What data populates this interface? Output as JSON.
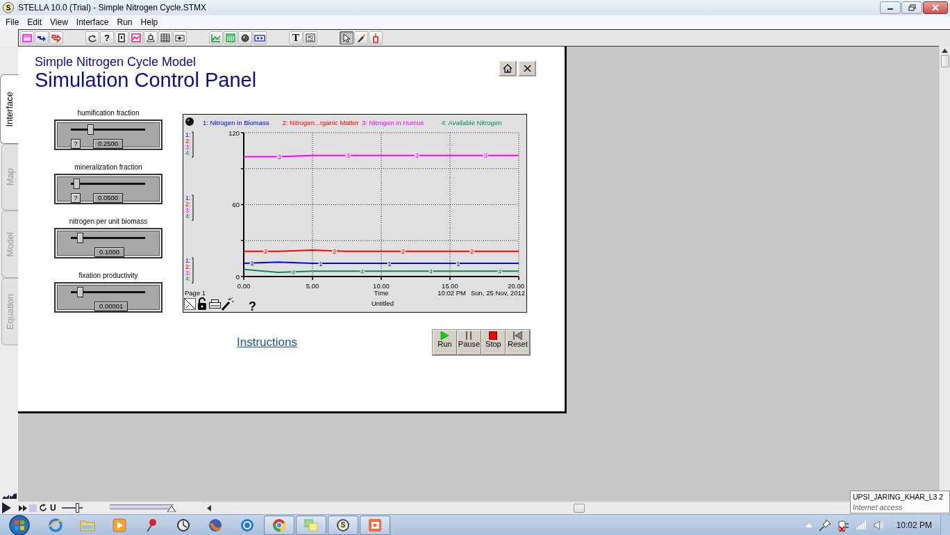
{
  "window": {
    "icon_letter": "S",
    "title": "STELLA 10.0 (Trial) - Simple Nitrogen Cycle.STMX"
  },
  "menu": [
    "File",
    "Edit",
    "View",
    "Interface",
    "Run",
    "Help"
  ],
  "toolbar": {
    "groups": [
      {
        "buttons": [
          {
            "selected": false
          },
          {
            "selected": false
          },
          {
            "selected": false
          }
        ]
      },
      {
        "buttons": [
          {
            "selected": false
          },
          {
            "label": "?",
            "selected": false
          },
          {
            "selected": false
          },
          {
            "selected": false
          },
          {
            "selected": false
          },
          {
            "selected": false
          },
          {
            "selected": false
          }
        ]
      },
      {
        "buttons": [
          {
            "selected": false
          },
          {
            "selected": false
          },
          {
            "selected": false
          },
          {
            "selected": false
          }
        ]
      },
      {
        "buttons": [
          {
            "label": "T",
            "selected": false
          },
          {
            "selected": false
          }
        ]
      },
      {
        "buttons": [
          {
            "selected": true
          },
          {
            "selected": false
          },
          {
            "selected": false
          }
        ]
      }
    ]
  },
  "side_tabs": [
    {
      "label": "Interface",
      "selected": true
    },
    {
      "label": "Map",
      "selected": false
    },
    {
      "label": "Model",
      "selected": false
    },
    {
      "label": "Equation",
      "selected": false
    }
  ],
  "panel": {
    "subtitle": "Simple Nitrogen Cycle Model",
    "title": "Simulation Control Panel",
    "sliders": [
      {
        "label": "humification fraction",
        "level": 0.27,
        "value": "0.2500",
        "help": "?"
      },
      {
        "label": "mineralization fraction",
        "level": 0.08,
        "value": "0.0500",
        "help": "?"
      },
      {
        "label": "nitrogen per unit biomass",
        "level": 0.13,
        "value": "0.1000"
      },
      {
        "label": "fixation productivity",
        "level": 0.13,
        "value": "0.00001"
      }
    ],
    "graph": {
      "page": "Page 1",
      "time": "10:02 PM",
      "date": "Sun, 25 Nov, 2012",
      "help": "?",
      "line_labels": [
        {
          "color": "#ff00ff",
          "labels": [
            "3",
            "3",
            "3",
            "3"
          ]
        },
        {
          "color": "#ff0000",
          "labels": [
            "2",
            "2",
            "2",
            "2"
          ]
        },
        {
          "color": "#0000ff",
          "labels": [
            "1",
            "1",
            "1",
            "1"
          ]
        },
        {
          "color": "#008f4c",
          "labels": [
            "4",
            "4",
            "4",
            "4"
          ]
        }
      ],
      "scale_groups": [
        {
          "labels": [
            "1:",
            "2:",
            "3:",
            "4:"
          ]
        },
        {
          "labels": [
            "1:",
            "2:",
            "3:",
            "4:"
          ]
        },
        {
          "labels": [
            "1:",
            "2:",
            "3:",
            "4:"
          ]
        }
      ],
      "chart_data": {
        "type": "line",
        "title": "Untitled",
        "xlabel": "Time",
        "x": [
          0,
          2.5,
          5,
          7.5,
          10,
          12.5,
          15,
          17.5,
          20
        ],
        "xlim": [
          0,
          20
        ],
        "ylim": [
          0,
          120
        ],
        "xticks": [
          {
            "value": 0,
            "label": "0.00"
          },
          {
            "value": 5,
            "label": "5.00"
          },
          {
            "value": 10,
            "label": "10.00"
          },
          {
            "value": 15,
            "label": "15.00"
          },
          {
            "value": 20,
            "label": "20.00"
          }
        ],
        "yticks": [
          0,
          60,
          120
        ],
        "grid": true,
        "series": [
          {
            "name": "1: Nitrogen in Biomass",
            "color": "#0000ff",
            "values": [
              11,
              12,
              11,
              11,
              11,
              11,
              11,
              11,
              11
            ]
          },
          {
            "name": "2: Nitrogen...rganic Matter",
            "color": "#ff0000",
            "values": [
              21,
              21,
              22,
              21,
              21,
              21,
              21,
              21,
              21
            ]
          },
          {
            "name": "3: Nitrogen in Humus",
            "color": "#ff00ff",
            "values": [
              100,
              100,
              101,
              101,
              101,
              101,
              101,
              101,
              101
            ]
          },
          {
            "name": "4: Available Nitrogen",
            "color": "#008f4c",
            "values": [
              6,
              3.5,
              4.5,
              4.5,
              4.5,
              4.5,
              4.5,
              4.5,
              4.5
            ]
          }
        ]
      }
    },
    "link": "Instructions",
    "run_buttons": [
      {
        "label": "Run"
      },
      {
        "label": "Pause"
      },
      {
        "label": "Stop"
      },
      {
        "label": "Reset"
      }
    ]
  },
  "sim_controls": {
    "u_label": "U",
    "speed": {
      "level": 0.77
    },
    "range": {
      "level": 0.97
    }
  },
  "tooltip": {
    "title": "UPSI_JARING_KHAR_L3  2",
    "subtitle": "Internet access"
  },
  "taskbar": {
    "clock": "10:02 PM",
    "apps": [
      {
        "open": false
      },
      {
        "open": false
      },
      {
        "open": false
      },
      {
        "open": false
      },
      {
        "open": false
      },
      {
        "open": false
      },
      {
        "open": false
      },
      {
        "open": true
      },
      {
        "open": true
      },
      {
        "open": true,
        "label": "S"
      },
      {
        "open": true
      }
    ]
  }
}
